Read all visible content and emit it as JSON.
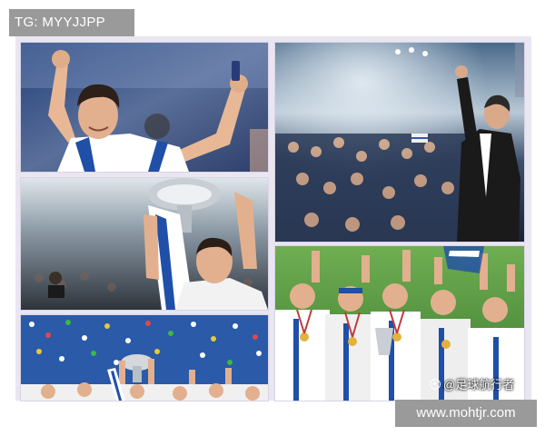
{
  "header_tag": {
    "text": "TG: MYYJJPP"
  },
  "footer_tag": {
    "text": "www.mohtjr.com"
  },
  "watermark": {
    "text": "@足球航行者",
    "icon": "weibo-logo-icon"
  },
  "photos": [
    {
      "id": "player-celebrating-with-bottle"
    },
    {
      "id": "coach-waving-to-crowd"
    },
    {
      "id": "player-with-trophy-and-flag"
    },
    {
      "id": "team-with-medals"
    },
    {
      "id": "team-lifting-trophy-confetti"
    }
  ],
  "colors": {
    "frame": "#e9e6f1",
    "tag_bg": "#9a9a9a",
    "greece_blue": "#1f4fa8",
    "pitch_green": "#4e9a3c"
  }
}
